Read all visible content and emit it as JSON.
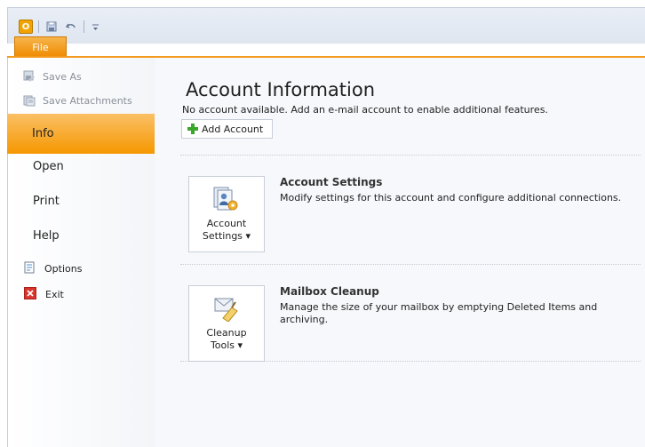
{
  "window": {
    "app_icon_letter": "O",
    "file_tab_label": "File",
    "qat": [
      "save-icon",
      "undo-icon",
      "customize-icon"
    ]
  },
  "sidebar": {
    "sub_items": [
      {
        "label": "Save As",
        "icon": "save-as-icon"
      },
      {
        "label": "Save Attachments",
        "icon": "save-attachments-icon"
      }
    ],
    "main_items": [
      {
        "label": "Info",
        "selected": true
      },
      {
        "label": "Open"
      },
      {
        "label": "Print"
      },
      {
        "label": "Help"
      }
    ],
    "options_items": [
      {
        "label": "Options",
        "icon": "options-icon"
      },
      {
        "label": "Exit",
        "icon": "exit-icon"
      }
    ]
  },
  "main": {
    "title": "Account Information",
    "description": "No account available. Add an e-mail account to enable additional features.",
    "add_account_label": "Add Account",
    "sections": [
      {
        "title": "Account Settings",
        "description": "Modify settings for this account and configure additional connections.",
        "button_line1": "Account",
        "button_line2": "Settings ▾",
        "icon": "account-settings-icon"
      },
      {
        "title": "Mailbox Cleanup",
        "description": "Manage the size of your mailbox by emptying Deleted Items and archiving.",
        "button_line1": "Cleanup",
        "button_line2": "Tools ▾",
        "icon": "cleanup-tools-icon"
      }
    ]
  },
  "colors": {
    "accent": "#f39b1e",
    "selected_bg": "#f8a93a",
    "plus_green": "#39a62c"
  }
}
